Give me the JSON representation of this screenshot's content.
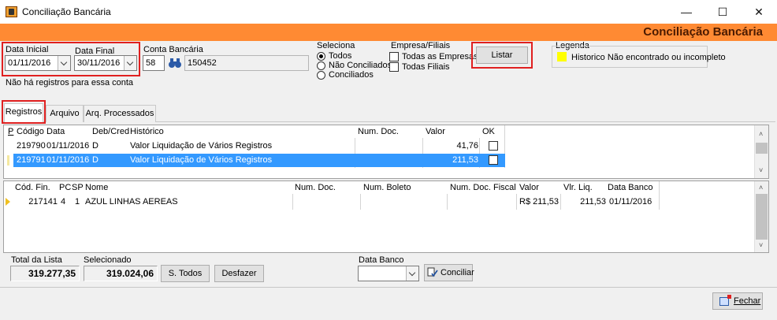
{
  "window": {
    "title": "Conciliação Bancária",
    "minimize": "—",
    "maximize": "☐",
    "close": "✕"
  },
  "header": {
    "title": "Conciliação Bancária",
    "accent_color": "#ff8a33"
  },
  "filters": {
    "data_inicial_label": "Data Inicial",
    "data_inicial_value": "01/11/2016",
    "data_final_label": "Data Final",
    "data_final_value": "30/11/2016",
    "conta_label": "Conta Bancária",
    "conta_code": "58",
    "conta_number": "150452",
    "message": "Não há registros para essa conta"
  },
  "seleciona": {
    "label": "Seleciona",
    "options": [
      "Todos",
      "Não Conciliados",
      "Conciliados"
    ],
    "selected": "Todos"
  },
  "empresa": {
    "label": "Empresa/Filiais",
    "todas_empresas": "Todas as Empresas",
    "todas_filiais": "Todas Filiais"
  },
  "listar_label": "Listar",
  "legenda": {
    "label": "Legenda",
    "item": "Historico Não encontrado ou incompleto",
    "swatch_color": "#ffff00"
  },
  "tabs": [
    "Registros",
    "Arquivo",
    "Arq. Processados"
  ],
  "registros": {
    "headers": {
      "p": "P",
      "codigo": "Código",
      "data": "Data",
      "debcred": "Deb/Cred",
      "historico": "Histórico",
      "numdoc": "Num. Doc.",
      "valor": "Valor",
      "ok": "OK"
    },
    "rows": [
      {
        "codigo": "219790",
        "data": "01/11/2016",
        "debcred": "D",
        "historico": "Valor Liquidação de Vários Registros",
        "numdoc": "",
        "valor": "41,76",
        "selected": false
      },
      {
        "codigo": "219791",
        "data": "01/11/2016",
        "debcred": "D",
        "historico": "Valor Liquidação de Vários Registros",
        "numdoc": "",
        "valor": "211,53",
        "selected": true
      }
    ]
  },
  "detalhes": {
    "headers": {
      "codfin": "Cód. Fin.",
      "pc": "PC",
      "sp": "SP",
      "nome": "Nome",
      "numdoc": "Num. Doc.",
      "numboleto": "Num. Boleto",
      "numdocfiscal": "Num. Doc. Fiscal",
      "valor": "Valor",
      "vlrliq": "Vlr. Liq.",
      "databanco": "Data Banco"
    },
    "rows": [
      {
        "codfin": "217141",
        "pc": "4",
        "sp": "1",
        "nome": "AZUL LINHAS AEREAS",
        "numdoc": "",
        "numboleto": "",
        "numdocfiscal": "",
        "valor": "R$ 211,53",
        "vlrliq": "211,53",
        "databanco": "01/11/2016"
      }
    ]
  },
  "footer": {
    "total_label": "Total da Lista",
    "total_value": "319.277,35",
    "selecionado_label": "Selecionado",
    "selecionado_value": "319.024,06",
    "stodos_label": "S. Todos",
    "desfazer_label": "Desfazer",
    "databanco_label": "Data Banco",
    "databanco_value": "",
    "conciliar_label": "Conciliar"
  },
  "fechar_label": "Fechar"
}
